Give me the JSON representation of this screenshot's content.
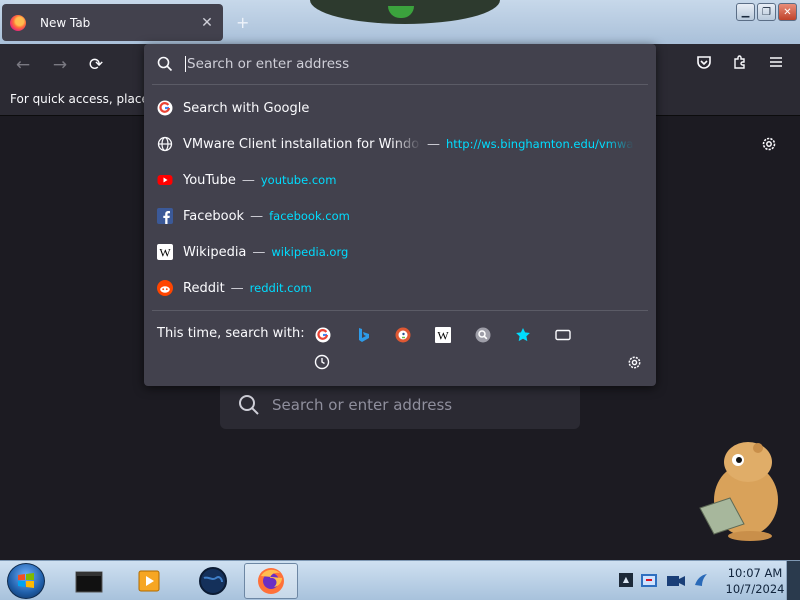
{
  "tab": {
    "title": "New Tab",
    "close": "✕",
    "new_tab": "+"
  },
  "window_buttons": {
    "minimize": "▁",
    "restore": "❐",
    "close": "✕"
  },
  "nav": {
    "back": "←",
    "forward": "→",
    "reload": "⟳"
  },
  "bookmarks_bar": {
    "text": "For quick access, place your bookmarks here on the bookmarks toolbar."
  },
  "urlbar": {
    "placeholder": "Search or enter address"
  },
  "results": [
    {
      "icon": "google-icon",
      "title": "Search with Google",
      "url": ""
    },
    {
      "icon": "globe-icon",
      "title": "VMware Client installation for Windows",
      "url": "http://ws.binghamton.edu/vmware"
    },
    {
      "icon": "youtube-icon",
      "title": "YouTube",
      "url": "youtube.com"
    },
    {
      "icon": "facebook-icon",
      "title": "Facebook",
      "url": "facebook.com"
    },
    {
      "icon": "wikipedia-icon",
      "title": "Wikipedia",
      "url": "wikipedia.org"
    },
    {
      "icon": "reddit-icon",
      "title": "Reddit",
      "url": "reddit.com"
    }
  ],
  "dash": "—",
  "one_off": {
    "label": "This time, search with:",
    "engines": [
      "google-icon",
      "bing-icon",
      "duckduckgo-icon",
      "wikipedia-icon",
      "search-engine-icon",
      "bookmarks-icon",
      "tabs-icon",
      "history-icon"
    ]
  },
  "content_search": {
    "placeholder": "Search or enter address"
  },
  "taskbar": {
    "clock_time": "10:07 AM",
    "clock_date": "10/7/2024"
  },
  "colors": {
    "accent_url": "#00ddff",
    "popup_bg": "#42414d",
    "page_bg": "#1c1b22",
    "toolbar_bg": "#2b2a33"
  }
}
